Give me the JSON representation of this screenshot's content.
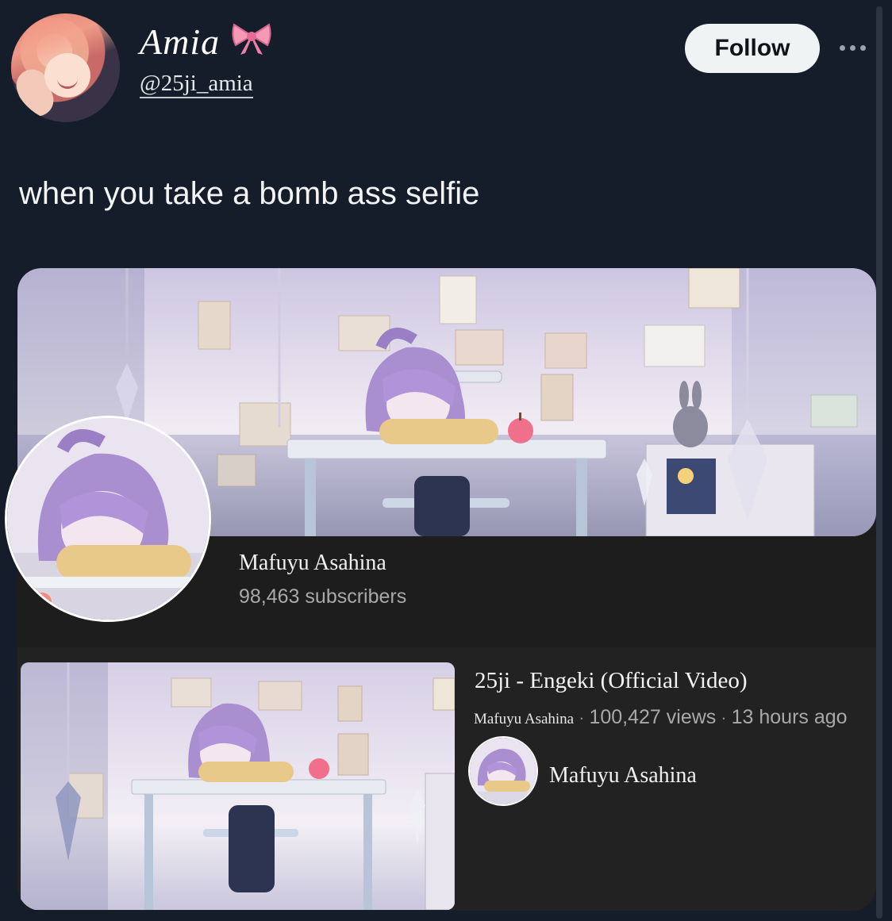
{
  "author": {
    "display_name": "Amia",
    "emoji": "🎀",
    "handle": "@25ji_amia",
    "avatar_icon": "profile-avatar"
  },
  "header": {
    "follow_label": "Follow",
    "more_icon": "more-options-icon"
  },
  "tweet": {
    "text": "when you take a bomb ass selfie"
  },
  "media": {
    "channel": {
      "name": "Mafuyu Asahina",
      "subscribers": "98,463 subscribers"
    },
    "video": {
      "title": "25ji - Engeki (Official Video)",
      "channel": "Mafuyu Asahina",
      "views": "100,427 views",
      "age": "13 hours ago",
      "separator": "·",
      "channel_row_name": "Mafuyu Asahina"
    }
  },
  "colors": {
    "background": "#141d29",
    "follow_button_bg": "#eff3f4",
    "card_bg": "#1c1c1c"
  }
}
